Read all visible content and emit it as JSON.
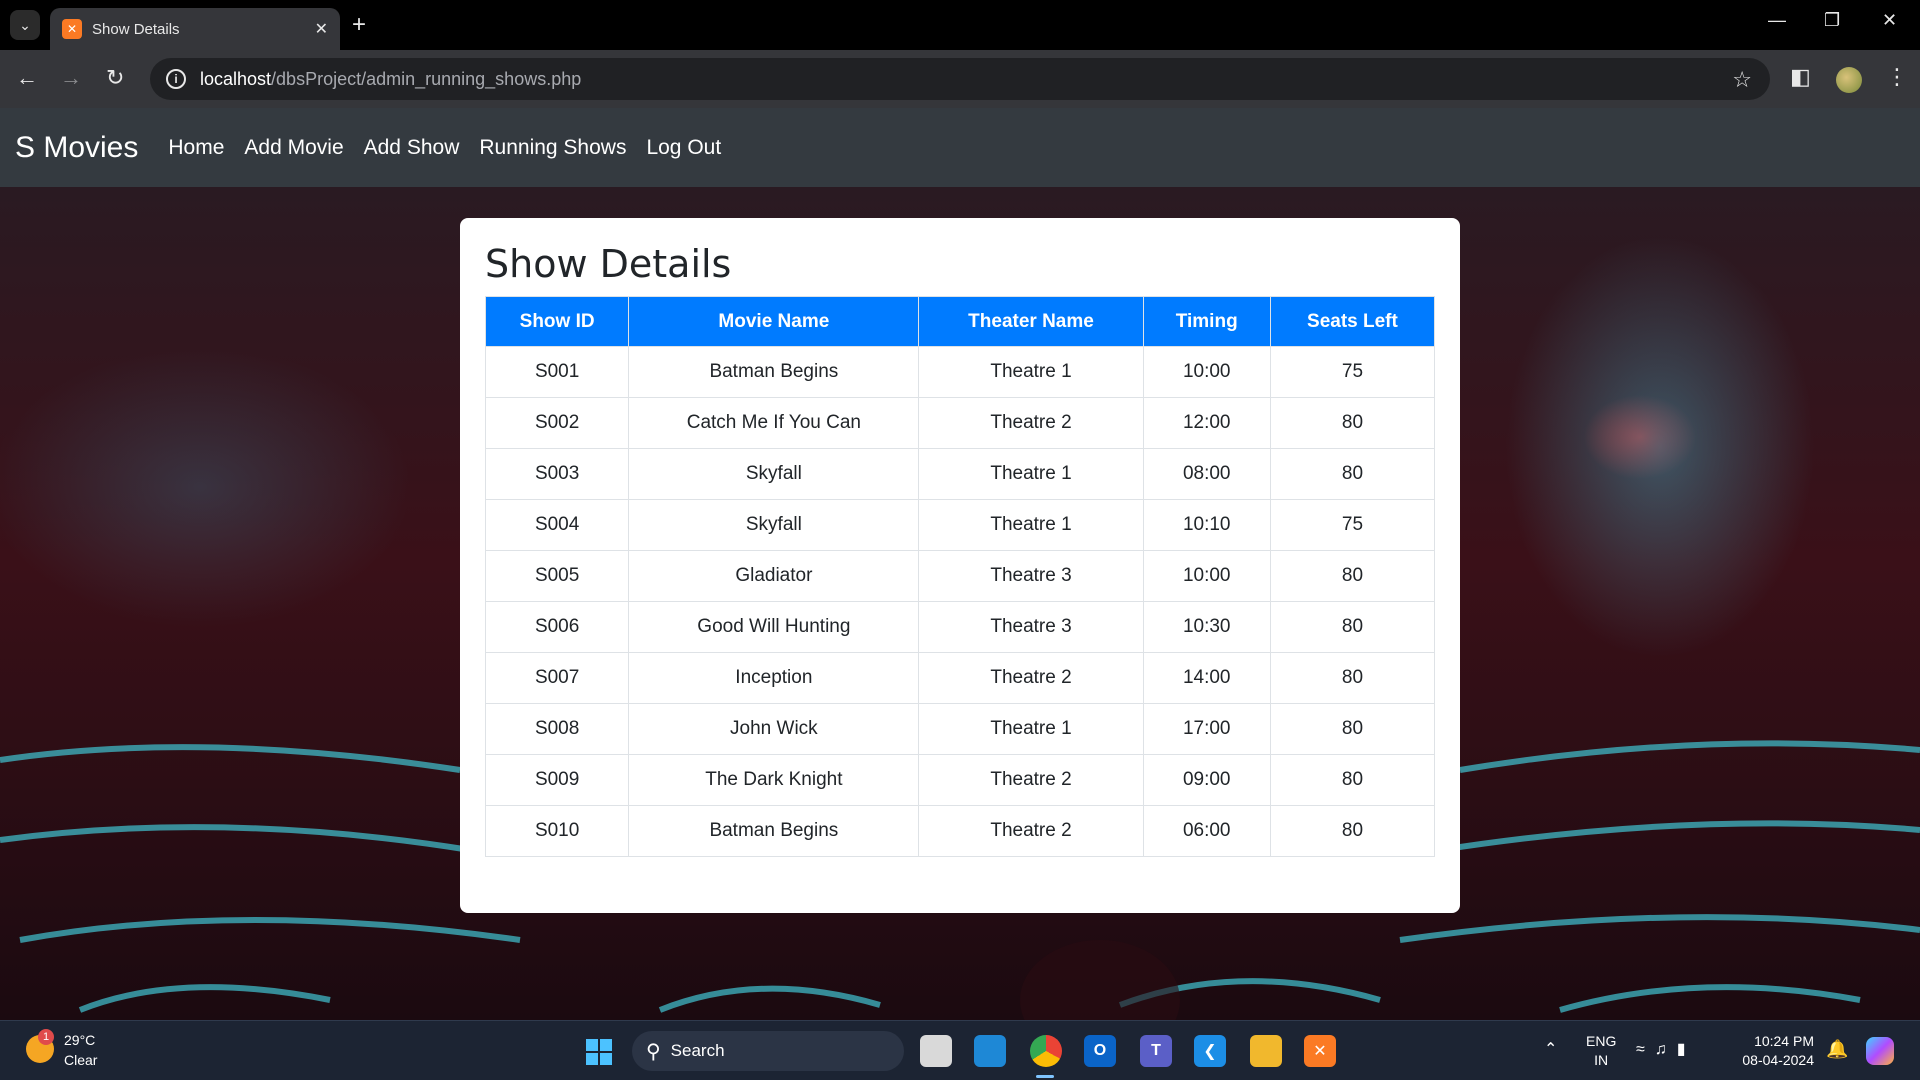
{
  "browser": {
    "tab_title": "Show Details",
    "url_host": "localhost",
    "url_path": "/dbsProject/admin_running_shows.php"
  },
  "nav": {
    "brand": "S Movies",
    "links": [
      "Home",
      "Add Movie",
      "Add Show",
      "Running Shows",
      "Log Out"
    ]
  },
  "card": {
    "title": "Show Details",
    "columns": [
      "Show ID",
      "Movie Name",
      "Theater Name",
      "Timing",
      "Seats Left"
    ],
    "rows": [
      [
        "S001",
        "Batman Begins",
        "Theatre 1",
        "10:00",
        "75"
      ],
      [
        "S002",
        "Catch Me If You Can",
        "Theatre 2",
        "12:00",
        "80"
      ],
      [
        "S003",
        "Skyfall",
        "Theatre 1",
        "08:00",
        "80"
      ],
      [
        "S004",
        "Skyfall",
        "Theatre 1",
        "10:10",
        "75"
      ],
      [
        "S005",
        "Gladiator",
        "Theatre 3",
        "10:00",
        "80"
      ],
      [
        "S006",
        "Good Will Hunting",
        "Theatre 3",
        "10:30",
        "80"
      ],
      [
        "S007",
        "Inception",
        "Theatre 2",
        "14:00",
        "80"
      ],
      [
        "S008",
        "John Wick",
        "Theatre 1",
        "17:00",
        "80"
      ],
      [
        "S009",
        "The Dark Knight",
        "Theatre 2",
        "09:00",
        "80"
      ],
      [
        "S010",
        "Batman Begins",
        "Theatre 2",
        "06:00",
        "80"
      ]
    ]
  },
  "taskbar": {
    "weather_temp": "29°C",
    "weather_cond": "Clear",
    "weather_badge": "1",
    "search_label": "Search",
    "lang_line1": "ENG",
    "lang_line2": "IN",
    "time": "10:24 PM",
    "date": "08-04-2024"
  },
  "colors": {
    "table_header": "#007bff",
    "navbar": "#343a40"
  }
}
